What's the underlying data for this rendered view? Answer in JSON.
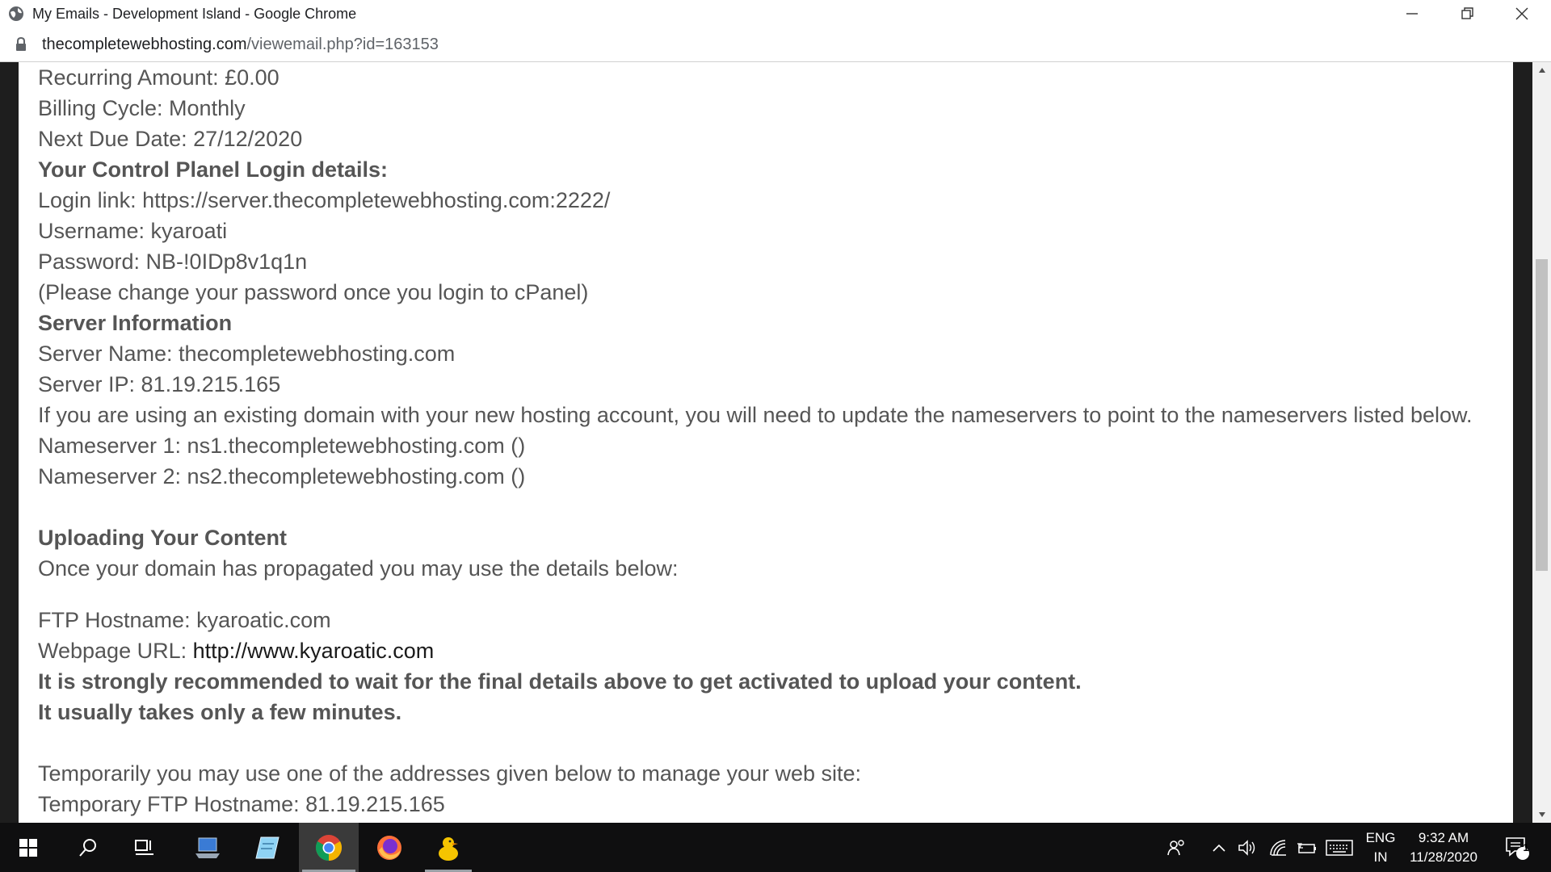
{
  "window": {
    "title": "My Emails - Development Island - Google Chrome"
  },
  "address_bar": {
    "domain": "thecompletewebhosting.com",
    "path": "/viewemail.php?id=163153"
  },
  "email": {
    "recurring_amount": "Recurring Amount: £0.00",
    "billing_cycle": "Billing Cycle: Monthly",
    "next_due_date": "Next Due Date: 27/12/2020",
    "control_panel_heading": "Your Control Planel Login details:",
    "login_link": "Login link: https://server.thecompletewebhosting.com:2222/",
    "username": "Username: kyaroati",
    "password": "Password: NB-!0IDp8v1q1n",
    "change_password_note": "(Please change your password once you login to cPanel)",
    "server_info_heading": "Server Information",
    "server_name": "Server Name: thecompletewebhosting.com",
    "server_ip": "Server IP: 81.19.215.165",
    "existing_domain_note": "If you are using an existing domain with your new hosting account, you will need to update the nameservers to point to the nameservers listed below.",
    "nameserver_1": "Nameserver 1: ns1.thecompletewebhosting.com ()",
    "nameserver_2": "Nameserver 2: ns2.thecompletewebhosting.com ()",
    "uploading_heading": "Uploading Your Content",
    "propagated_note": "Once your domain has propagated you may use the details below:",
    "ftp_hostname": "FTP Hostname: kyaroatic.com",
    "webpage_url_label": "Webpage URL: ",
    "webpage_url_link": "http://www.kyaroatic.com",
    "recommend_wait": "It is strongly recommended to wait for the final details above to get activated to upload your content.",
    "few_minutes": "It usually takes only a few minutes.",
    "temporary_note": "Temporarily you may use one of the addresses given below to manage your web site:",
    "temp_ftp_hostname": "Temporary FTP Hostname: 81.19.215.165"
  },
  "taskbar": {
    "apps": [
      "start-icon",
      "search-icon",
      "task-view-icon",
      "laptop-icon",
      "notepad-icon",
      "chrome-icon",
      "firefox-icon",
      "duck-icon"
    ],
    "active_app": "chrome-icon",
    "language_top": "ENG",
    "language_bottom": "IN",
    "time": "9:32 AM",
    "date": "11/28/2020",
    "notification_count": "1"
  },
  "colors": {
    "body_text": "#555555",
    "link_text": "#1a1a1a",
    "side_bands": "#1e1e1e",
    "taskbar_bg": "#0f0f10"
  }
}
